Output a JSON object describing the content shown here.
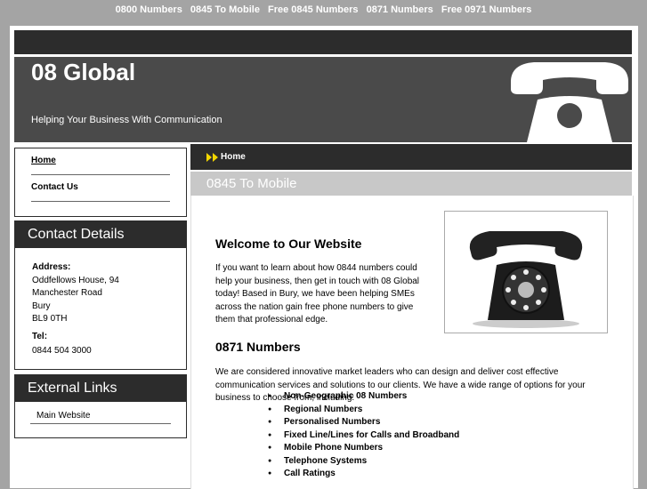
{
  "top_nav": [
    "0800 Numbers",
    "0845 To Mobile",
    "Free 0845 Numbers",
    "0871 Numbers",
    "Free 0971 Numbers"
  ],
  "header": {
    "title": "08 Global",
    "tagline": "Helping Your Business With Communication"
  },
  "menu": [
    "Home",
    "Contact Us"
  ],
  "contact": {
    "heading": "Contact Details",
    "address_label": "Address:",
    "address_lines": [
      "Oddfellows House, 94",
      "Manchester Road",
      "Bury",
      "BL9 0TH"
    ],
    "tel_label": "Tel:",
    "tel": "0844 504 3000"
  },
  "external": {
    "heading": "External Links",
    "items": [
      "Main Website"
    ]
  },
  "breadcrumb": "Home",
  "subheading": "0845 To Mobile",
  "main": {
    "welcome_heading": "Welcome to Our Website",
    "welcome_lines": [
      "If you want to learn about how 0844 numbers could",
      "help your business, then get in touch with 08 Global",
      "today! Based in Bury, we have been helping SMEs",
      "across the nation gain free phone numbers to give",
      "them that professional edge."
    ],
    "section_heading": "0871 Numbers",
    "section_lines": [
      "We are considered innovative market leaders who can design and deliver cost effective",
      "communication services and solutions to our clients. We have a wide range of options for your",
      "business to choose from, including:"
    ],
    "services": [
      "Non-Geographic 08 Numbers",
      "Regional Numbers",
      "Personalised Numbers",
      "Fixed Line/Lines for Calls and Broadband",
      "Mobile Phone Numbers",
      "Telephone Systems",
      "Call Ratings"
    ]
  },
  "colors": {
    "page_bg": "#a4a4a4",
    "dark_bar": "#2c2c2c",
    "header_bg": "#4a4a4a",
    "sub_bar": "#c8c8c8"
  }
}
